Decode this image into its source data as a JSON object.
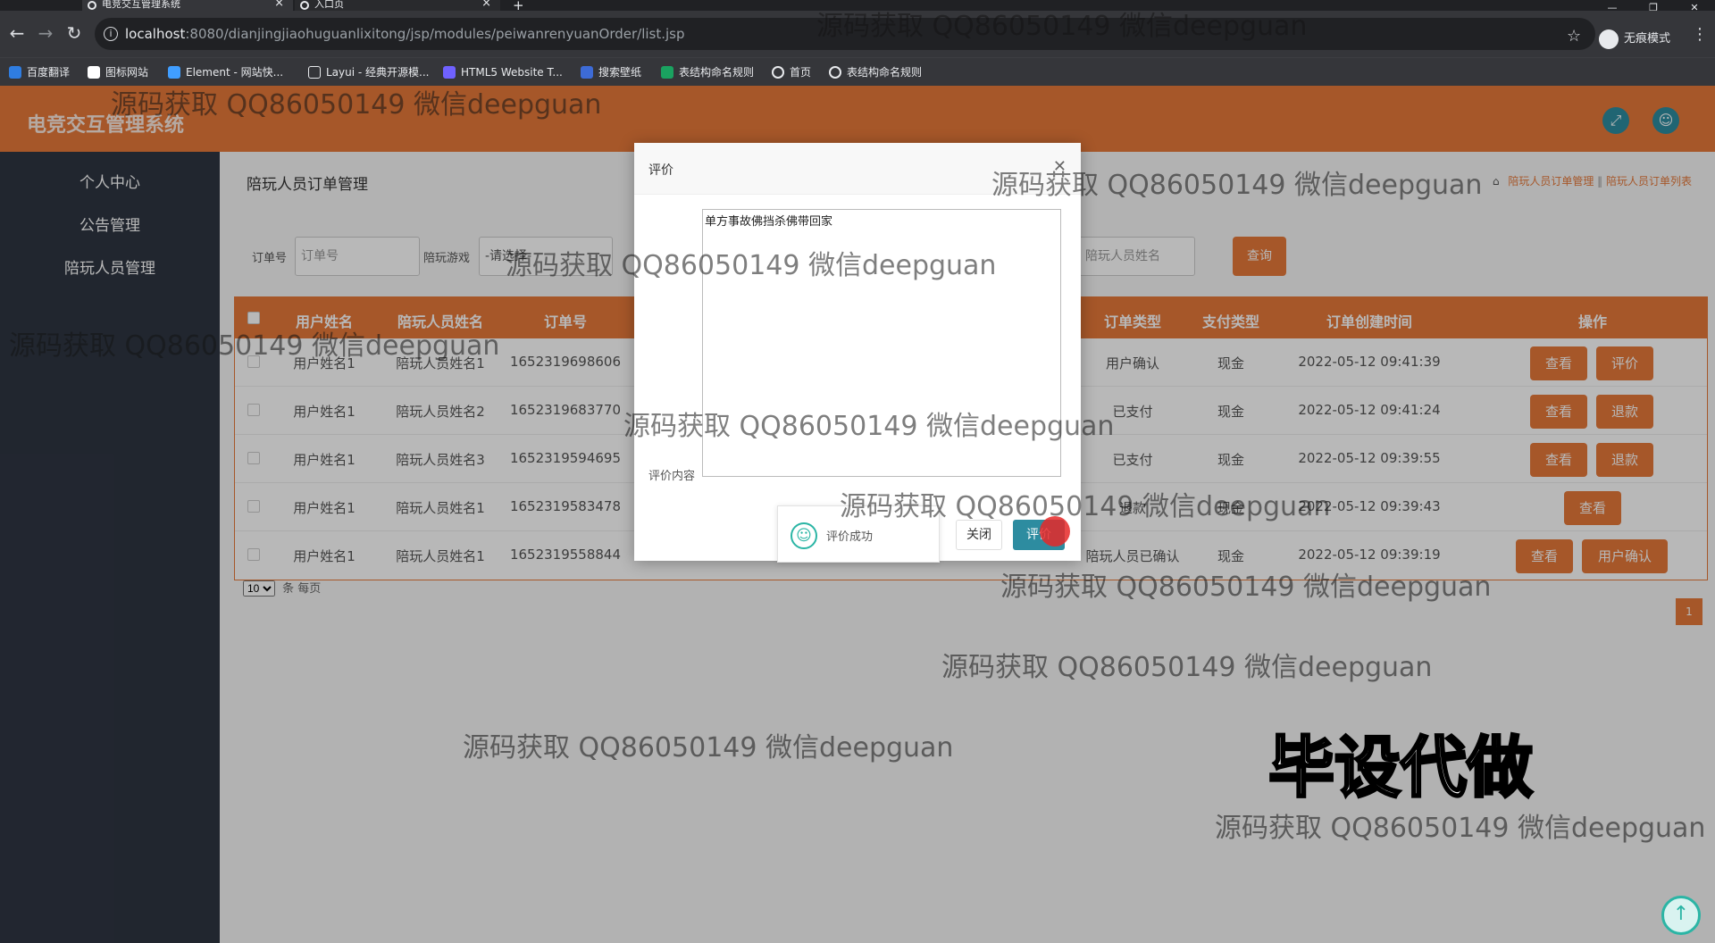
{
  "browser": {
    "tabs": [
      {
        "title": "电竞交互管理系统",
        "close": "×"
      },
      {
        "title": "入口页",
        "close": "×"
      }
    ],
    "new_tab": "+",
    "window_controls": [
      "—",
      "❐",
      "✕"
    ],
    "url_host": "localhost",
    "url_path": ":8080/dianjingjiaohuguanlixitong/jsp/modules/peiwanrenyuanOrder/list.jsp",
    "incognito_label": "无痕模式",
    "bookmarks": [
      "百度翻译",
      "图标网站",
      "Element - 网站快...",
      "Layui - 经典开源模...",
      "HTML5 Website T...",
      "搜索壁纸",
      "表结构命名规则",
      "首页",
      "表结构命名规则"
    ]
  },
  "app": {
    "title": "电竞交互管理系统",
    "sidebar": [
      "个人中心",
      "公告管理",
      "陪玩人员管理"
    ],
    "page_heading": "陪玩人员订单管理",
    "breadcrumb": [
      "陪玩人员订单管理",
      "陪玩人员订单列表"
    ],
    "search": {
      "order_label": "订单号",
      "order_placeholder": "订单号",
      "game_label": "陪玩游戏",
      "game_value": "-请选择-",
      "staff_placeholder": "陪玩人员姓名",
      "button": "查询"
    },
    "table": {
      "headers": [
        "用户姓名",
        "陪玩人员姓名",
        "订单号",
        "订单类型",
        "支付类型",
        "订单创建时间",
        "操作"
      ],
      "rows": [
        {
          "user": "用户姓名1",
          "staff": "陪玩人员姓名1",
          "order_no": "1652319698606",
          "type": "用户确认",
          "pay": "现金",
          "time": "2022-05-12 09:41:39",
          "actions": [
            "查看",
            "评价"
          ]
        },
        {
          "user": "用户姓名1",
          "staff": "陪玩人员姓名2",
          "order_no": "1652319683770",
          "type": "已支付",
          "pay": "现金",
          "time": "2022-05-12 09:41:24",
          "actions": [
            "查看",
            "退款"
          ]
        },
        {
          "user": "用户姓名1",
          "staff": "陪玩人员姓名3",
          "order_no": "1652319594695",
          "type": "已支付",
          "pay": "现金",
          "time": "2022-05-12 09:39:55",
          "actions": [
            "查看",
            "退款"
          ]
        },
        {
          "user": "用户姓名1",
          "staff": "陪玩人员姓名1",
          "order_no": "1652319583478",
          "type": "退款",
          "pay": "现金",
          "time": "2022-05-12 09:39:43",
          "actions": [
            "查看"
          ]
        },
        {
          "user": "用户姓名1",
          "staff": "陪玩人员姓名1",
          "order_no": "1652319558844",
          "type": "陪玩人员已确认",
          "pay": "现金",
          "time": "2022-05-12 09:39:19",
          "actions": [
            "查看",
            "用户确认"
          ]
        }
      ]
    },
    "pager": {
      "per_page": "10",
      "per_page_suffix": "条 每页",
      "current_page": "1"
    }
  },
  "modal": {
    "title": "评价",
    "close_icon": "✕",
    "field_label": "评价内容",
    "textarea_value": "单方事故佛挡杀佛带回家",
    "toast_text": "评价成功",
    "close_button": "关闭",
    "submit_button": "评价"
  },
  "watermark": {
    "text": "源码获取 QQ86050149 微信deepguan",
    "stamp": "毕设代做"
  },
  "colors": {
    "accent": "#e6793a",
    "sidebar": "#2f3542",
    "teal": "#2d8ca0"
  }
}
